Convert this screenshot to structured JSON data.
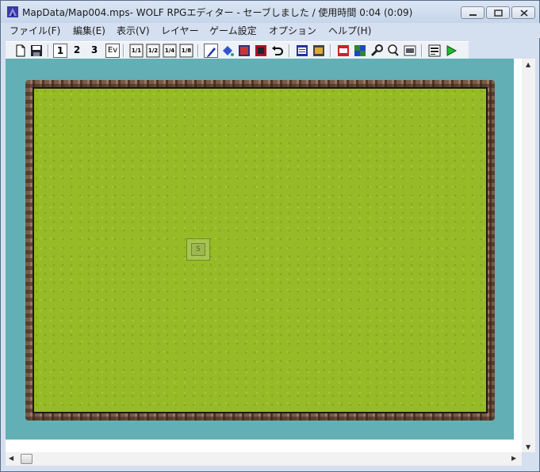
{
  "window": {
    "title": "MapData/Map004.mps- WOLF RPGエディター - セーブしました / 使用時間 0:04 (0:09)"
  },
  "menubar": {
    "items": [
      "ファイル(F)",
      "編集(E)",
      "表示(V)",
      "レイヤー",
      "ゲーム設定",
      "オプション",
      "ヘルプ(H)"
    ]
  },
  "toolbar": {
    "layer1": "1",
    "layer2": "2",
    "layer3": "3",
    "event_layer": "Ev",
    "zoom_labels": [
      "1/1",
      "1/2",
      "1/4",
      "1/8"
    ]
  },
  "map": {
    "event_marker": "S"
  },
  "colors": {
    "water": "#62b0b5",
    "grass": "#96bb26",
    "border": "#7a5a46"
  }
}
